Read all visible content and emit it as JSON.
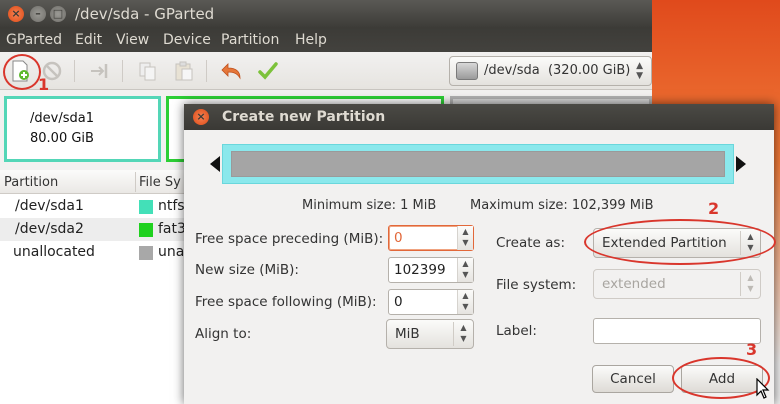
{
  "window": {
    "title": "/dev/sda - GParted"
  },
  "menubar": {
    "items": [
      "GParted",
      "Edit",
      "View",
      "Device",
      "Partition",
      "Help"
    ]
  },
  "device_selector": {
    "value": "/dev/sda",
    "size": "(320.00 GiB)"
  },
  "graph": {
    "partition1_name": "/dev/sda1",
    "partition1_size": "80.00 GiB"
  },
  "table": {
    "headers": [
      "Partition",
      "File Sy"
    ],
    "rows": [
      {
        "partition": "/dev/sda1",
        "fs": "ntfs",
        "color": "#43e0b8"
      },
      {
        "partition": "/dev/sda2",
        "fs": "fat3",
        "color": "#1fd11f"
      },
      {
        "partition": "unallocated",
        "fs": "una",
        "color": "#a8a8a8"
      }
    ]
  },
  "dialog": {
    "title": "Create new Partition",
    "min_size": "Minimum size: 1 MiB",
    "max_size": "Maximum size: 102,399 MiB",
    "fields": {
      "free_preceding_label": "Free space preceding (MiB):",
      "free_preceding_value": "0",
      "new_size_label": "New size (MiB):",
      "new_size_value": "102399",
      "free_following_label": "Free space following (MiB):",
      "free_following_value": "0",
      "align_label": "Align to:",
      "align_value": "MiB",
      "create_as_label": "Create as:",
      "create_as_value": "Extended Partition",
      "file_system_label": "File system:",
      "file_system_value": "extended",
      "label_label": "Label:",
      "label_value": ""
    },
    "buttons": {
      "cancel": "Cancel",
      "add": "Add"
    }
  },
  "annotations": {
    "step1": "1",
    "step2": "2",
    "step3": "3",
    "color": "#d9362c"
  }
}
